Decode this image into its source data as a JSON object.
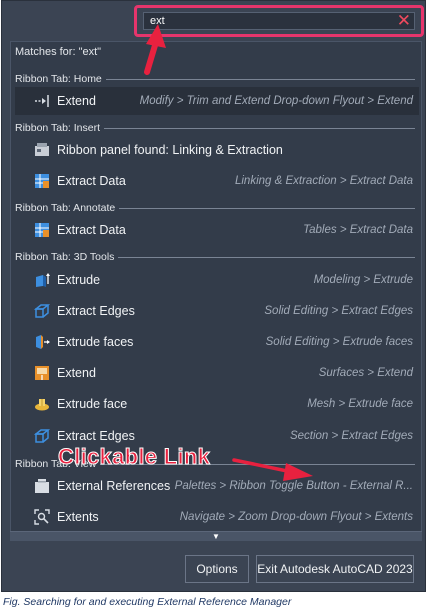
{
  "search": {
    "value": "ext",
    "clear_glyph": "✕"
  },
  "matches_label": "Matches for: \"ext\"",
  "sections": [
    {
      "heading": "Ribbon Tab: Home"
    },
    {
      "heading": "Ribbon Tab: Insert"
    },
    {
      "heading": "Ribbon Tab: Annotate"
    },
    {
      "heading": "Ribbon Tab: 3D Tools"
    },
    {
      "heading": "Ribbon Tab: View"
    }
  ],
  "results": [
    {
      "label": "Extend",
      "path": "Modify > Trim and Extend Drop-down Flyout > Extend",
      "icon": "extend-icon",
      "selected": true
    },
    {
      "label": "Ribbon panel found: Linking & Extraction",
      "path": "",
      "icon": "ribbon-panel-icon"
    },
    {
      "label": "Extract  Data",
      "path": "Linking & Extraction > Extract  Data",
      "icon": "extract-data-icon"
    },
    {
      "label": "Extract Data",
      "path": "Tables > Extract Data",
      "icon": "extract-data-icon"
    },
    {
      "label": "Extrude",
      "path": "Modeling > Extrude",
      "icon": "extrude-icon"
    },
    {
      "label": "Extract Edges",
      "path": "Solid Editing > Extract Edges",
      "icon": "extract-edges-icon"
    },
    {
      "label": "Extrude faces",
      "path": "Solid Editing > Extrude faces",
      "icon": "extrude-faces-icon"
    },
    {
      "label": "Extend",
      "path": "Surfaces > Extend",
      "icon": "surface-extend-icon"
    },
    {
      "label": "Extrude face",
      "path": "Mesh > Extrude face",
      "icon": "mesh-extrude-icon"
    },
    {
      "label": "Extract Edges",
      "path": "Section > Extract Edges",
      "icon": "extract-edges-icon"
    },
    {
      "label": "External References",
      "path": "Palettes > Ribbon Toggle Button - External R...",
      "icon": "xref-icon"
    },
    {
      "label": "Extents",
      "path": "Navigate > Zoom Drop-down Flyout > Extents",
      "icon": "zoom-extents-icon"
    }
  ],
  "buttons": {
    "options": "Options",
    "exit": "Exit Autodesk AutoCAD 2023"
  },
  "annotation": "Clickable Link",
  "caption": "Fig. Searching for and executing External Reference Manager",
  "colors": {
    "highlight_border": "#e6356c",
    "arrow": "#e8213f",
    "panel_bg": "#3b4453",
    "icon_blue": "#3d8fe0",
    "icon_orange": "#e8902a"
  }
}
